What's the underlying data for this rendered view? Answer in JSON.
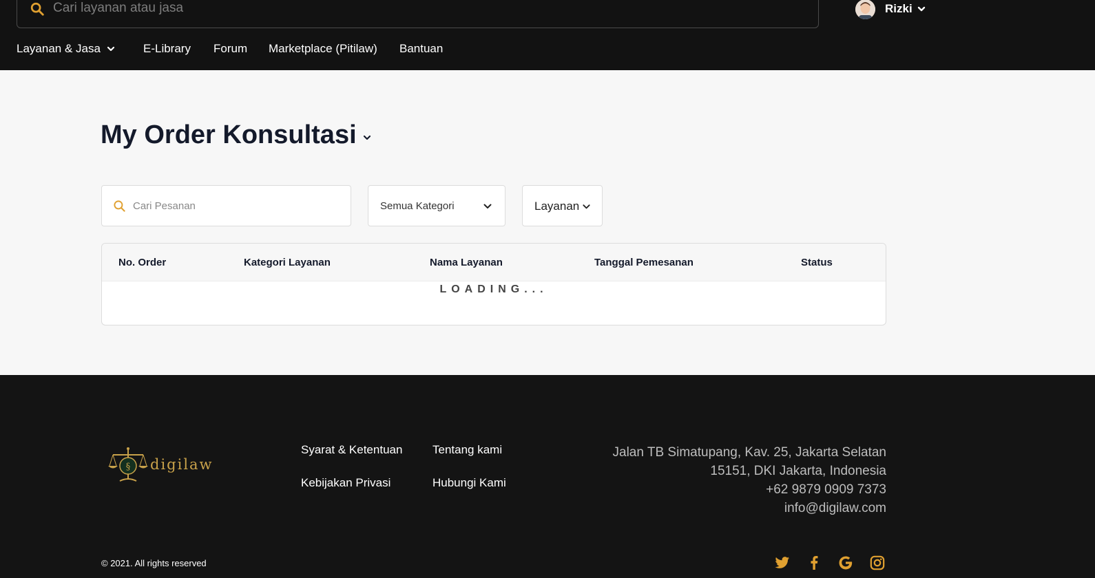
{
  "header": {
    "search_placeholder": "Cari layanan atau jasa",
    "user_name": "Rizki",
    "nav": [
      {
        "label": "Layanan & Jasa"
      },
      {
        "label": "E-Library"
      },
      {
        "label": "Forum"
      },
      {
        "label": "Marketplace (Pitilaw)"
      },
      {
        "label": "Bantuan"
      }
    ]
  },
  "main": {
    "title": "My Order Konsultasi",
    "search_placeholder": "Cari Pesanan",
    "category_select": "Semua Kategori",
    "service_select": "Layanan",
    "table": {
      "columns": [
        "No. Order",
        "Kategori Layanan",
        "Nama Layanan",
        "Tanggal Pemesanan",
        "Status"
      ],
      "loading_text": "LOADING..."
    }
  },
  "footer": {
    "logo_text": "digilaw",
    "links": [
      "Syarat & Ketentuan",
      "Tentang kami",
      "Kebijakan Privasi",
      "Hubungi Kami"
    ],
    "address_lines": [
      "Jalan TB Simatupang, Kav. 25, Jakarta Selatan",
      "15151, DKI Jakarta, Indonesia",
      "+62 9879 0909 7373",
      "info@digilaw.com"
    ],
    "copyright": "© 2021. All rights reserved",
    "socials": [
      "twitter-icon",
      "facebook-icon",
      "google-icon",
      "instagram-icon"
    ]
  },
  "colors": {
    "accent": "#e0a030",
    "header_bg": "#121212",
    "footer_bg": "#141414",
    "page_bg": "#f7f7f7"
  }
}
